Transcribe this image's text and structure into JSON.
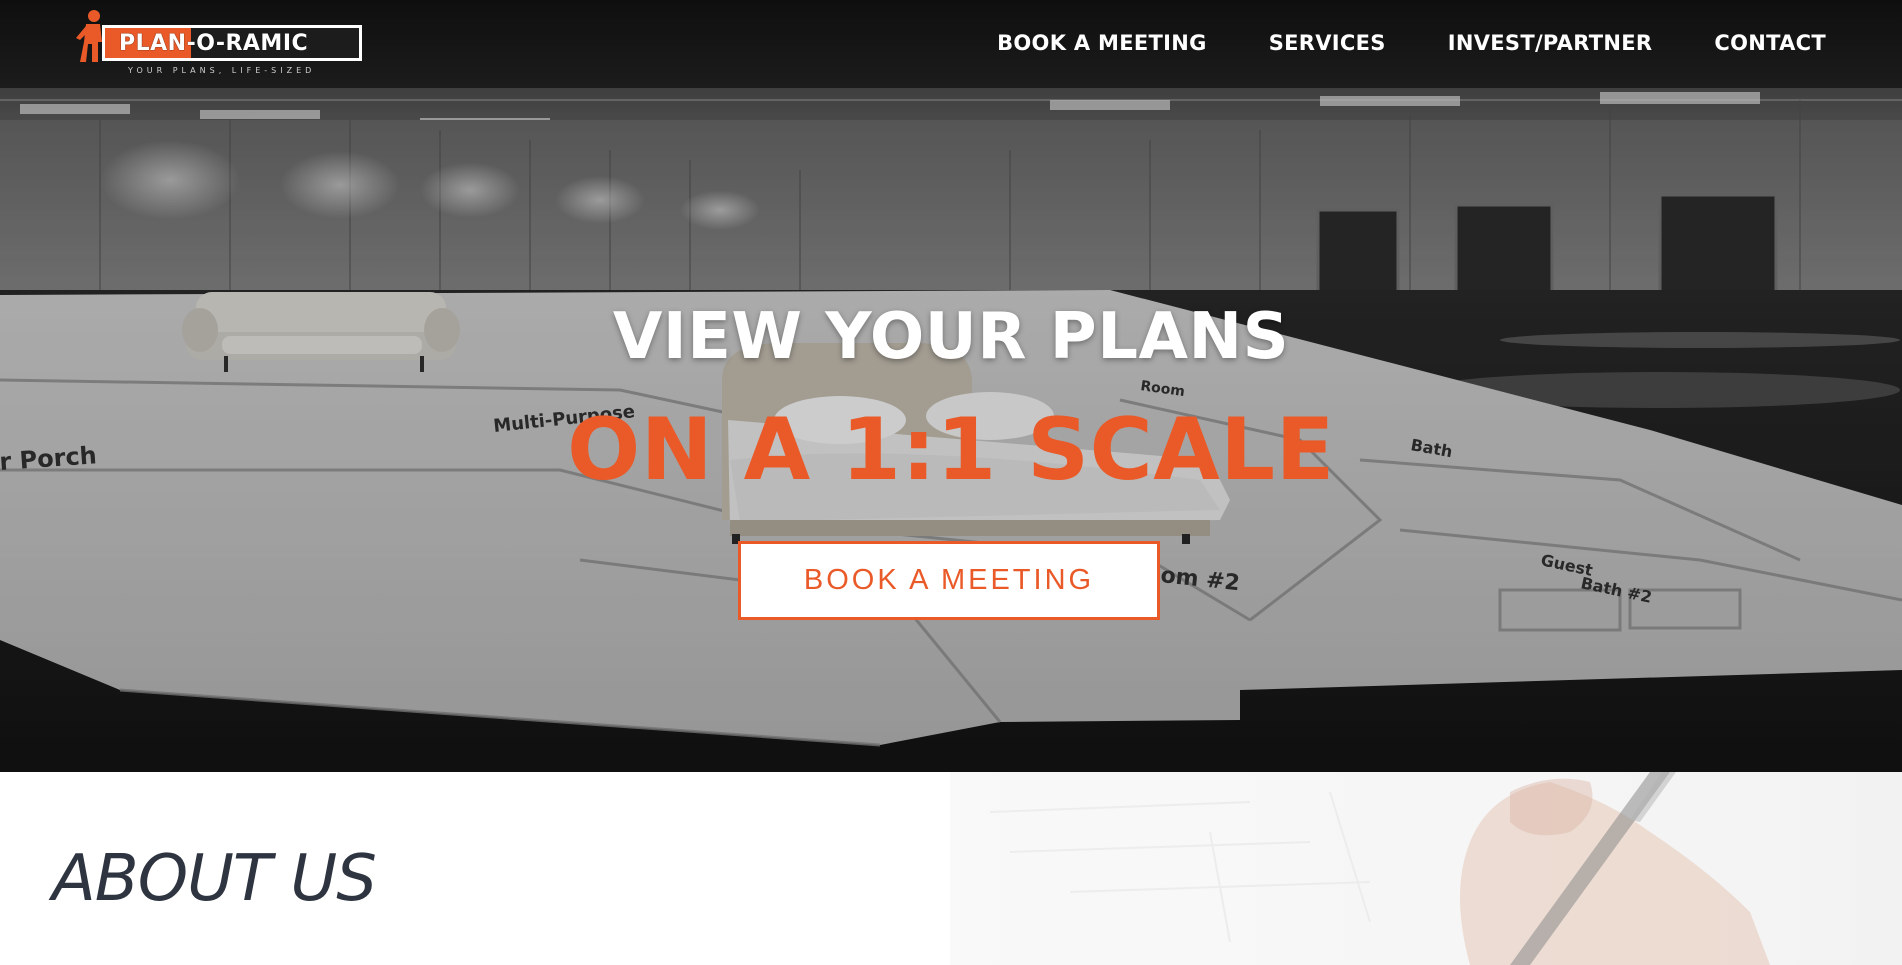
{
  "header": {
    "logo": {
      "text": "PLAN-O-RAMIC",
      "tagline": "YOUR PLANS, LIFE-SIZED"
    },
    "nav": [
      {
        "label": "BOOK A MEETING"
      },
      {
        "label": "SERVICES"
      },
      {
        "label": "INVEST/PARTNER"
      },
      {
        "label": "CONTACT"
      }
    ]
  },
  "hero": {
    "title_line1": "VIEW YOUR PLANS",
    "title_line2": "ON A 1:1 SCALE",
    "cta_label": "BOOK A MEETING",
    "floorplan_labels": {
      "porch": "r Porch",
      "multi": "Multi-Purpose",
      "bath": "Bath",
      "guest_bath": "Guest Bath #2",
      "bedroom": "om #2"
    }
  },
  "about": {
    "title": "ABOUT US"
  },
  "colors": {
    "accent": "#ea5a28",
    "header_bg": "#000000",
    "about_title": "#2e3440"
  }
}
